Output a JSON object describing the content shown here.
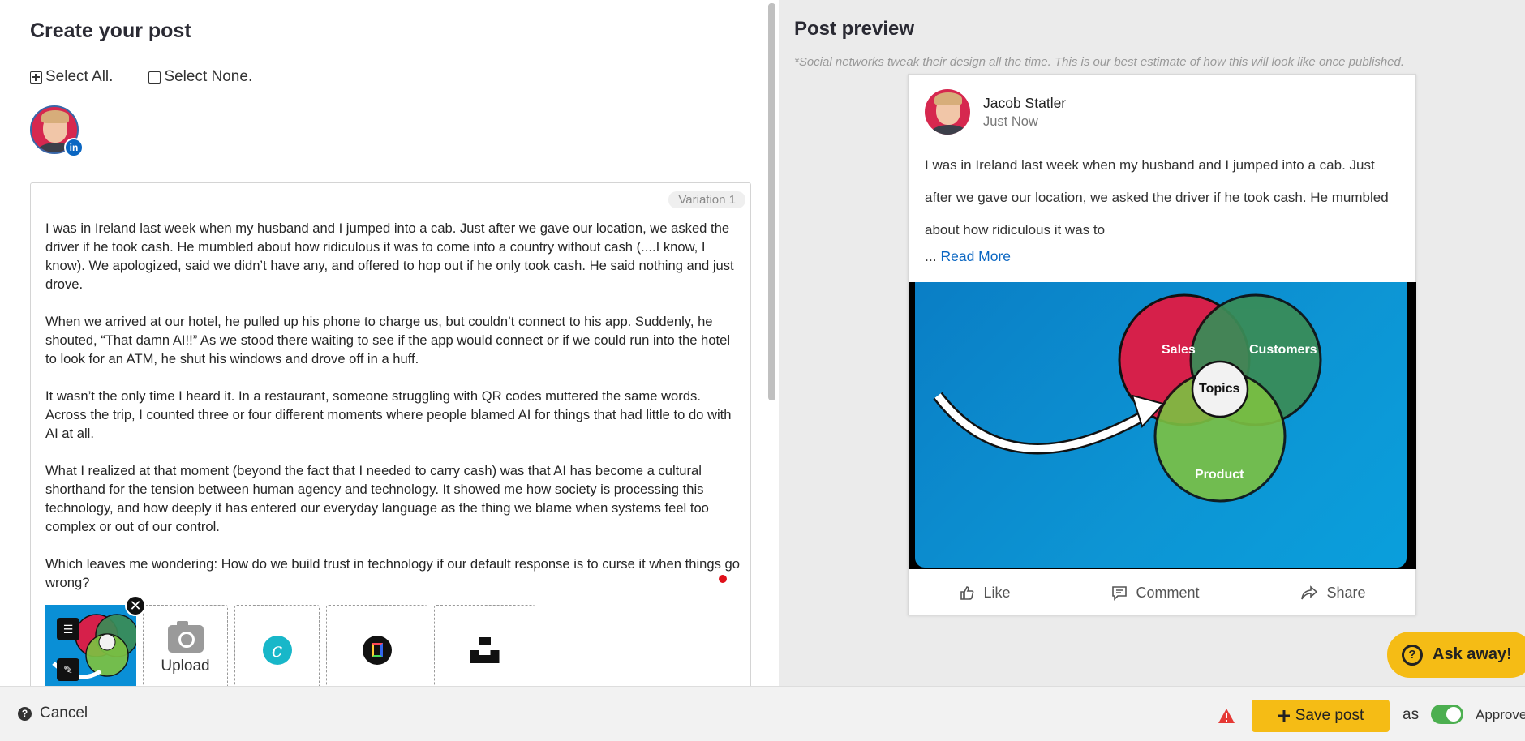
{
  "left": {
    "title": "Create your post",
    "select_all": "Select All.",
    "select_none": "Select None.",
    "network_badge": "in",
    "variation_label": "Variation 1",
    "paragraphs": [
      "I was in Ireland last week when my husband and I jumped into a cab. Just after we gave our location, we asked the driver if he took cash. He mumbled about how ridiculous it was to come into a country without cash (....I know, I know). We apologized, said we didn’t have any, and offered to hop out if he only took cash. He said nothing and just drove.",
      "When we arrived at our hotel, he pulled up his phone to charge us, but couldn’t connect to his app. Suddenly, he shouted, “That damn AI!!” As we stood there waiting to see if the app would connect or if we could run into the hotel to look for an ATM, he shut his windows and drove off in a huff.",
      "It wasn’t the only time I heard it. In a restaurant, someone struggling with QR codes muttered the same words. Across the trip, I counted three or four different moments where people blamed AI for things that had little to do with AI at all.",
      "What I realized at that moment (beyond the fact that I needed to carry cash) was that AI has become a cultural shorthand for the tension between human agency and technology. It showed me how society is processing this technology, and how deeply it has entered our everyday language as the thing we blame when systems feel too complex or out of our control.",
      "Which leaves me wondering: How do we build trust in technology if our default response is to curse it when things go wrong?"
    ],
    "upload_label": "Upload"
  },
  "right": {
    "title": "Post preview",
    "note": "*Social networks tweak their design all the time. This is our best estimate of how this will look like once published.",
    "author": "Jacob Statler",
    "time": "Just Now",
    "excerpt": "I was in Ireland last week when my husband and I jumped into a cab. Just after we gave our location, we asked the driver if he took cash. He mumbled about how ridiculous it was to",
    "ellipsis": "...",
    "read_more": "Read More",
    "venn": {
      "a": "Sales",
      "b": "Customers",
      "c": "Product",
      "center": "Topics"
    },
    "like": "Like",
    "comment": "Comment",
    "share": "Share",
    "ask": "Ask away!"
  },
  "footer": {
    "cancel": "Cancel",
    "save": "Save post",
    "as": "as",
    "approved": "Approved"
  },
  "colors": {
    "accent": "#f5bc15",
    "linkedin": "#0a66c2",
    "toggle_on": "#4caf50",
    "venn_sales": "#d6204a",
    "venn_customers": "#3a8c57",
    "venn_product": "#7cc142"
  },
  "icons": [
    "plus-square-icon",
    "square-icon",
    "linkedin-icon",
    "close-icon",
    "text-icon",
    "pencil-icon",
    "camera-icon",
    "canva-icon",
    "giphy-icon",
    "unsplash-icon",
    "thumbs-up-icon",
    "comment-icon",
    "share-icon",
    "question-icon",
    "warning-icon",
    "plus-icon"
  ]
}
